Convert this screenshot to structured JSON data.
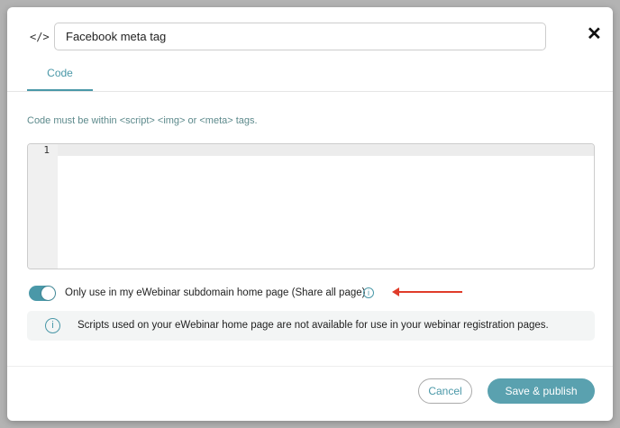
{
  "modal": {
    "code_icon": "</>",
    "name_value": "Facebook meta tag",
    "close_glyph": "✕",
    "tabs": [
      {
        "label": "Code",
        "active": true
      }
    ],
    "hint": "Code must be within <script> <img> or <meta> tags.",
    "editor": {
      "line_numbers": [
        "1"
      ],
      "content": ""
    },
    "toggle": {
      "on": true,
      "label": "Only use in my eWebinar subdomain home page (Share all page)",
      "info_glyph": "i"
    },
    "notice": {
      "info_glyph": "i",
      "text": "Scripts used on your eWebinar home page are not available for use in your webinar registration pages."
    },
    "buttons": {
      "cancel": "Cancel",
      "save": "Save & publish"
    },
    "colors": {
      "accent": "#4a98a8",
      "annotation_arrow": "#e03c2a"
    }
  }
}
